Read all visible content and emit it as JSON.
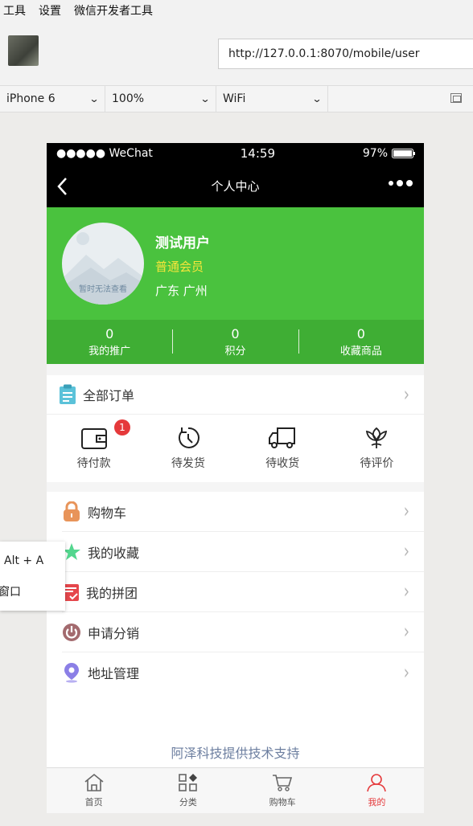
{
  "menubar": {
    "items": [
      "工具",
      "设置",
      "微信开发者工具"
    ]
  },
  "address": {
    "url": "http://127.0.0.1:8070/mobile/user"
  },
  "devbar": {
    "device": "iPhone 6",
    "zoom": "100%",
    "network": "WiFi"
  },
  "status": {
    "carrier": "●●●●● WeChat",
    "time": "14:59",
    "battery": "97%"
  },
  "nav": {
    "title": "个人中心"
  },
  "profile": {
    "avatar_caption": "暂时无法查看",
    "name": "测试用户",
    "level": "普通会员",
    "location": "广东 广州"
  },
  "stats": [
    {
      "value": "0",
      "label": "我的推广"
    },
    {
      "value": "0",
      "label": "积分"
    },
    {
      "value": "0",
      "label": "收藏商品"
    }
  ],
  "orders": {
    "title": "全部订单",
    "items": [
      {
        "label": "待付款",
        "badge": "1",
        "icon": "wallet-icon"
      },
      {
        "label": "待发货",
        "icon": "clock-icon"
      },
      {
        "label": "待收货",
        "icon": "truck-icon"
      },
      {
        "label": "待评价",
        "icon": "flower-icon"
      }
    ]
  },
  "menu": [
    {
      "label": "购物车",
      "icon": "lock-icon",
      "color": "#e8945a"
    },
    {
      "label": "我的收藏",
      "icon": "star-icon",
      "color": "#53d68e"
    },
    {
      "label": "我的拼团",
      "icon": "clipboard-icon",
      "color": "#e5464b"
    },
    {
      "label": "申请分销",
      "icon": "power-icon",
      "color": "#a36a6e"
    },
    {
      "label": "地址管理",
      "icon": "location-pin-icon",
      "color": "#8b7fe6"
    }
  ],
  "support_text": "阿泽科技提供技术支持",
  "tabs": [
    {
      "label": "首页",
      "icon": "home-icon"
    },
    {
      "label": "分类",
      "icon": "category-icon"
    },
    {
      "label": "购物车",
      "icon": "cart-icon"
    },
    {
      "label": "我的",
      "icon": "user-icon",
      "active": true
    }
  ],
  "context_menu": {
    "shortcut": "Alt + A",
    "item": "窗口"
  },
  "colors": {
    "header_green": "#4ac23e",
    "stats_green": "#3fae34",
    "badge_red": "#e5393b",
    "level_yellow": "#f6e63a"
  }
}
